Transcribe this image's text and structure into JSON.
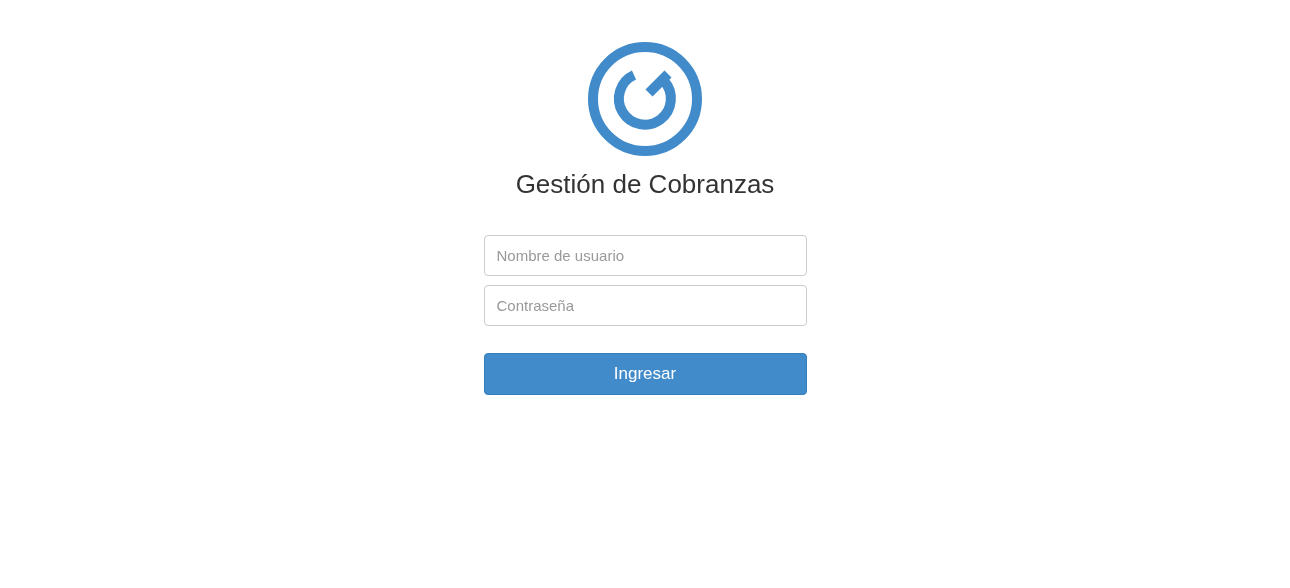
{
  "title": "Gestión de Cobranzas",
  "fields": [
    {
      "placeholder": "Nombre de usuario"
    },
    {
      "placeholder": "Contraseña"
    }
  ],
  "button": "Ingresar"
}
